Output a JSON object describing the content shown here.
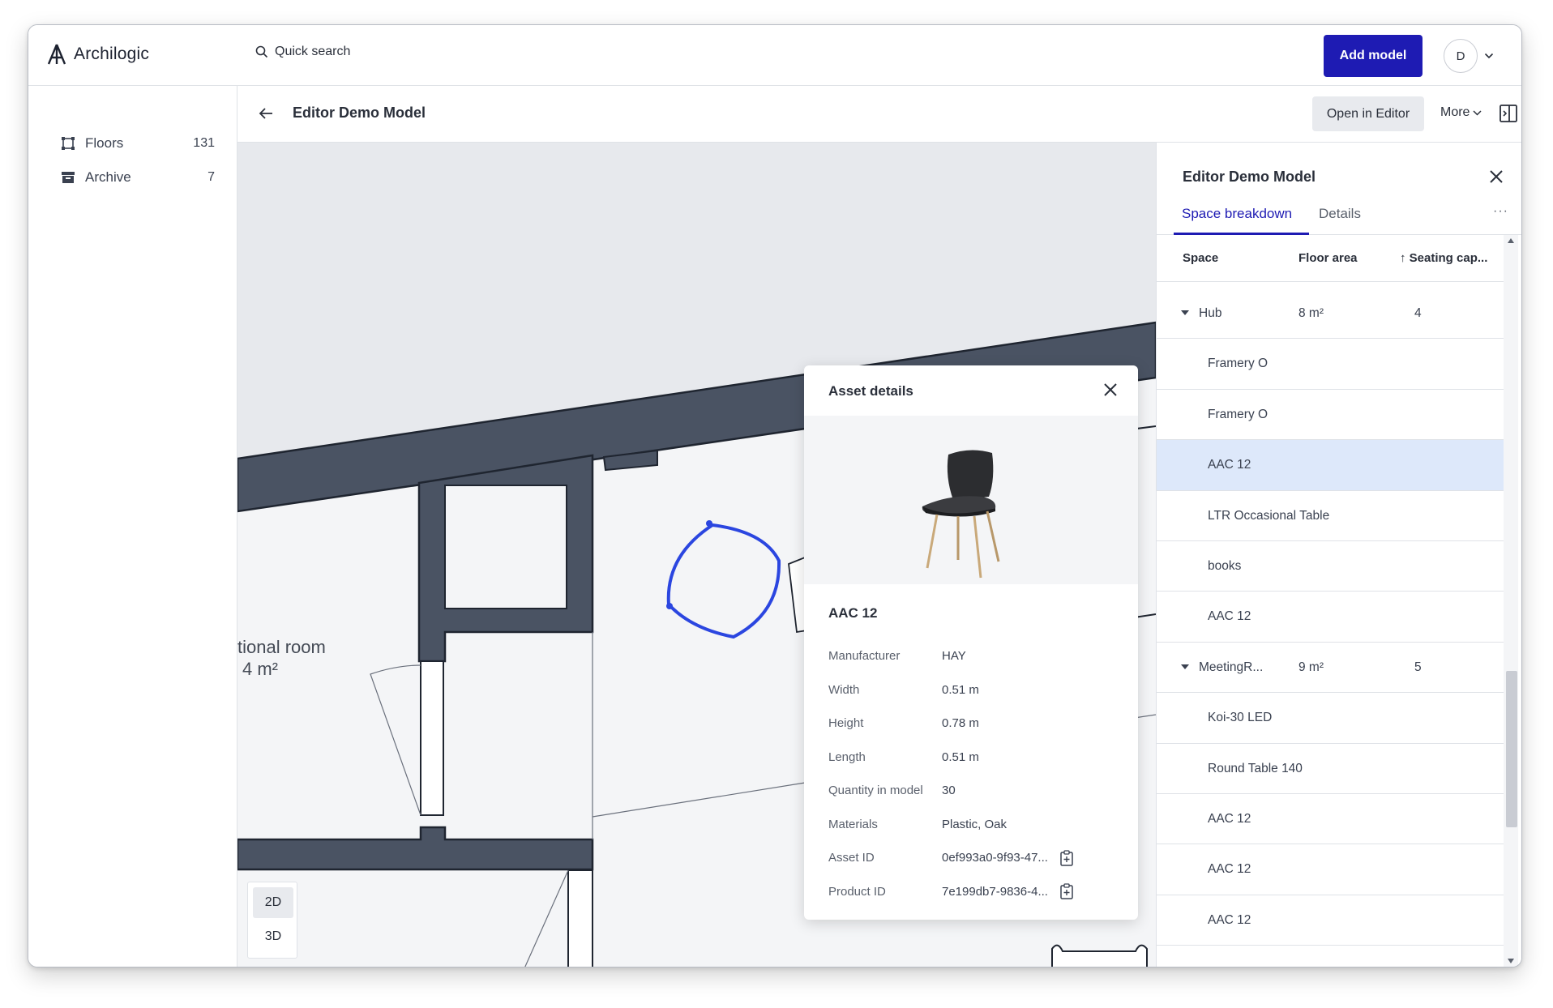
{
  "app": {
    "name": "Archilogic"
  },
  "search": {
    "placeholder": "Quick search"
  },
  "header": {
    "add_model": "Add model",
    "user_initial": "D"
  },
  "sidebar": {
    "items": [
      {
        "label": "Floors",
        "count": "131",
        "icon": "floor-plan-icon"
      },
      {
        "label": "Archive",
        "count": "7",
        "icon": "archive-box-icon"
      }
    ]
  },
  "model_header": {
    "title": "Editor Demo Model",
    "open_in_editor": "Open in Editor",
    "more": "More"
  },
  "canvas": {
    "room_label": "tional room",
    "room_area": "4 m²",
    "view_modes": [
      "2D",
      "3D"
    ],
    "active_view": "2D",
    "selection_color": "#2b46e0",
    "wall_color": "#4a5363"
  },
  "asset_details": {
    "heading": "Asset details",
    "name": "AAC 12",
    "properties": [
      {
        "key": "Manufacturer",
        "value": "HAY"
      },
      {
        "key": "Width",
        "value": "0.51 m"
      },
      {
        "key": "Height",
        "value": "0.78 m"
      },
      {
        "key": "Length",
        "value": "0.51 m"
      },
      {
        "key": "Quantity in model",
        "value": "30"
      },
      {
        "key": "Materials",
        "value": "Plastic, Oak"
      },
      {
        "key": "Asset ID",
        "value": "0ef993a0-9f93-47..."
      },
      {
        "key": "Product ID",
        "value": "7e199db7-9836-4..."
      }
    ]
  },
  "right_panel": {
    "title": "Editor Demo Model",
    "tabs": [
      "Space breakdown",
      "Details"
    ],
    "active_tab": "Space breakdown",
    "columns": [
      "Space",
      "Floor area",
      "↑ Seating cap..."
    ],
    "rows": [
      {
        "name": "Hub",
        "area": "8 m²",
        "seats": "4",
        "group": true
      },
      {
        "name": "Framery O"
      },
      {
        "name": "Framery O"
      },
      {
        "name": "AAC 12",
        "selected": true
      },
      {
        "name": "LTR Occasional Table"
      },
      {
        "name": "books"
      },
      {
        "name": "AAC 12"
      },
      {
        "name": "MeetingR...",
        "area": "9 m²",
        "seats": "5",
        "group": true
      },
      {
        "name": "Koi-30 LED"
      },
      {
        "name": "Round Table 140"
      },
      {
        "name": "AAC 12"
      },
      {
        "name": "AAC 12"
      },
      {
        "name": "AAC 12"
      }
    ]
  },
  "colors": {
    "accent": "#1e1bb3",
    "selected_row": "#dde8fa"
  }
}
